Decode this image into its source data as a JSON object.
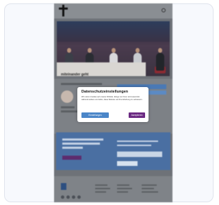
{
  "site": {
    "logo_text": "",
    "hero_caption": "miteinander geht"
  },
  "modal": {
    "title": "Datenschutzeinstellungen",
    "body": "Wir nutzen Cookies auf unserer Website. Einige von ihnen sind essenziell, während andere uns helfen, diese Website und Ihre Erfahrung zu verbessern.",
    "button_left": "Einstellungen",
    "button_right": "Akzeptieren"
  },
  "colors": {
    "modal_primary": "#6b2a82",
    "modal_secondary": "#4b86c8",
    "panel_blue": "#4a6fa2"
  }
}
